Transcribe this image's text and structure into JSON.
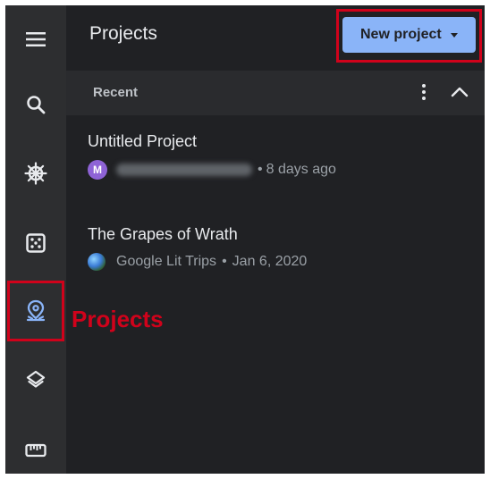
{
  "header": {
    "title": "Projects",
    "new_project_label": "New project"
  },
  "section": {
    "label": "Recent"
  },
  "projects": [
    {
      "title": "Untitled Project",
      "avatar_letter": "M",
      "time": "8 days ago"
    },
    {
      "title": "The Grapes of Wrath",
      "owner": "Google Lit Trips",
      "date": "Jan 6, 2020"
    }
  ],
  "separator": "•",
  "annotation": {
    "text": "Projects"
  },
  "rail": {
    "icons": [
      "menu-icon",
      "search-icon",
      "voyager-wheel-icon",
      "dice-icon",
      "projects-pin-icon",
      "layers-icon",
      "ruler-icon"
    ]
  },
  "colors": {
    "accent": "#8ab4f8",
    "highlight": "#d0021b",
    "background": "#202124",
    "rail": "#2d2e30",
    "avatar": "#8e63d6"
  }
}
